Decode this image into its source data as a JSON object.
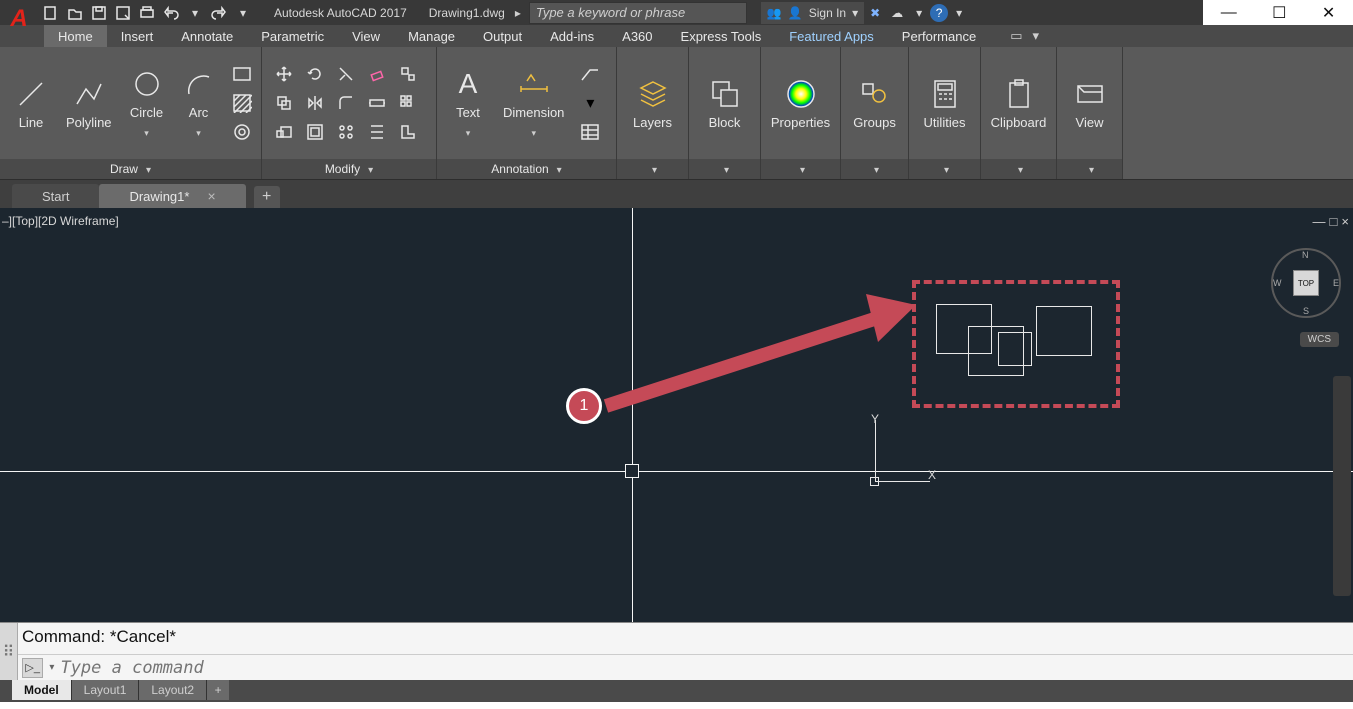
{
  "title": {
    "app": "Autodesk AutoCAD 2017",
    "doc": "Drawing1.dwg",
    "search_placeholder": "Type a keyword or phrase",
    "signin": "Sign In"
  },
  "tabs": {
    "list": [
      "Home",
      "Insert",
      "Annotate",
      "Parametric",
      "View",
      "Manage",
      "Output",
      "Add-ins",
      "A360",
      "Express Tools",
      "Featured Apps",
      "Performance"
    ],
    "active": "Home"
  },
  "ribbon": {
    "draw": {
      "title": "Draw",
      "line": "Line",
      "polyline": "Polyline",
      "circle": "Circle",
      "arc": "Arc"
    },
    "modify": {
      "title": "Modify"
    },
    "annotation": {
      "title": "Annotation",
      "text": "Text",
      "dimension": "Dimension"
    },
    "layers": {
      "title": "Layers"
    },
    "block": {
      "title": "Block"
    },
    "properties": {
      "title": "Properties"
    },
    "groups": {
      "title": "Groups"
    },
    "utilities": {
      "title": "Utilities"
    },
    "clipboard": {
      "title": "Clipboard"
    },
    "view": {
      "title": "View"
    }
  },
  "filetabs": {
    "start": "Start",
    "drawing": "Drawing1*"
  },
  "viewport": {
    "label": "–][Top][2D Wireframe]",
    "ucs_x": "X",
    "ucs_y": "Y",
    "cube_top": "TOP",
    "cube_n": "N",
    "cube_s": "S",
    "cube_e": "E",
    "cube_w": "W",
    "wcs": "WCS"
  },
  "annotation_marker": "1",
  "command": {
    "history": "Command: *Cancel*",
    "placeholder": "Type a command"
  },
  "layouts": {
    "model": "Model",
    "l1": "Layout1",
    "l2": "Layout2"
  }
}
